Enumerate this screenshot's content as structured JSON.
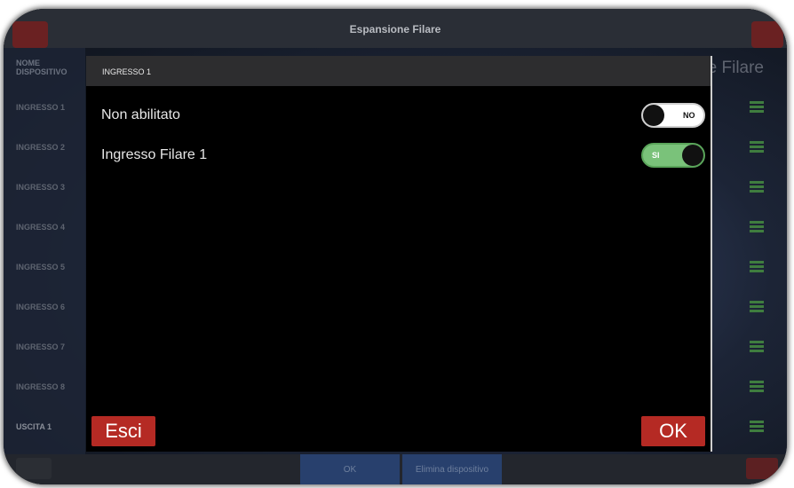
{
  "window": {
    "title": "Espansione Filare"
  },
  "background": {
    "title_fragment": "e Filare",
    "column_header": "NOME DISPOSITIVO",
    "items": [
      "INGRESSO 1",
      "INGRESSO 2",
      "INGRESSO 3",
      "INGRESSO 4",
      "INGRESSO 5",
      "INGRESSO 6",
      "INGRESSO 7",
      "INGRESSO 8",
      "USCITA 1"
    ],
    "bottom_buttons": {
      "ok": "OK",
      "delete": "Elimina dispositivo"
    }
  },
  "dialog": {
    "title": "INGRESSO 1",
    "options": [
      {
        "label": "Non abilitato",
        "toggle_text": "NO",
        "state": "off"
      },
      {
        "label": "Ingresso Filare 1",
        "toggle_text": "SI",
        "state": "on"
      }
    ],
    "cancel_label": "Esci",
    "ok_label": "OK"
  },
  "colors": {
    "accent_red": "#b52a24",
    "toggle_on": "#7ac27a",
    "menu_green": "#3f7d3f"
  },
  "icons": [
    "hamburger-menu-icon"
  ]
}
